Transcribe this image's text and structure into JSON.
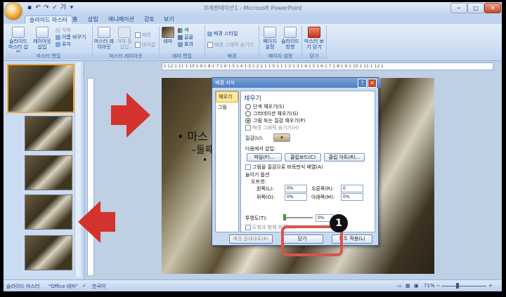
{
  "window": {
    "title": "프레젠테이션1 - Microsoft PowerPoint",
    "qat_icons": [
      "save-icon",
      "undo-icon",
      "redo-icon",
      "check-icon",
      "text-icon",
      "dropdown-icon"
    ],
    "controls": {
      "minimize": "─",
      "maximize": "□",
      "close": "✕"
    }
  },
  "tabs": [
    "슬라이드 마스터",
    "홈",
    "삽입",
    "애니메이션",
    "검토",
    "보기"
  ],
  "ribbon": {
    "groups": {
      "master_edit": {
        "label": "마스터 편집",
        "insert_master": "슬라이드 마스터 삽입",
        "insert_layout": "레이아웃 삽입",
        "delete": "삭제",
        "rename": "이름 바꾸기",
        "preserve": "유지"
      },
      "master_layout": {
        "label": "마스터 레이아웃",
        "master_layout": "마스터 레이아웃",
        "insert_placeholder": "개체 틀 삽입",
        "title": "제목",
        "footer": "바닥글"
      },
      "edit_theme": {
        "label": "테마 편집",
        "theme": "테마",
        "colors": "색",
        "fonts": "글꼴",
        "effects": "효과"
      },
      "background": {
        "label": "배경",
        "styles": "배경 스타일",
        "hide_graphics": "배경 그래픽 숨기기"
      },
      "page_setup": {
        "label": "페이지 설정",
        "setup": "페이지 설정",
        "orientation": "슬라이드 방향"
      },
      "close": {
        "label": "닫기",
        "close_view": "마스터 보기 닫기"
      }
    }
  },
  "thumbnails": {
    "numbers": [
      "1",
      "",
      "",
      "",
      "",
      ""
    ],
    "selected_index": 0
  },
  "slide": {
    "title": "마",
    "bullet1": "• 마스",
    "bullet2": "–둘째",
    "bullet3": "•"
  },
  "dialog": {
    "title": "배경 서식",
    "help": "?",
    "close": "✕",
    "categories": [
      "채우기",
      "그림"
    ],
    "fill_heading": "채우기",
    "options": [
      {
        "label": "단색 채우기(S)",
        "selected": false
      },
      {
        "label": "그라데이션 채우기(G)",
        "selected": false
      },
      {
        "label": "그림 또는 질감 채우기(P)",
        "selected": true
      },
      {
        "label": "배경 그래픽 숨기기(H)",
        "selected": false
      }
    ],
    "texture_label": "질감(U):",
    "insert_from": "다음에서 삽입:",
    "btn_file": "파일(F)...",
    "btn_clipboard": "클립보드(C)",
    "btn_clipart": "클립 아트(R)...",
    "tile_checkbox": "그림을 질감으로 바둑판식 배열(A)",
    "stretch_options": "늘이기 옵션",
    "offsets": "오프셋:",
    "left_label": "왼쪽(L):",
    "left_value": "0%",
    "right_label": "오른쪽(R):",
    "right_value": "0",
    "top_label": "위쪽(O):",
    "top_value": "0%",
    "bottom_label": "아래쪽(M):",
    "bottom_value": "0%",
    "transparency_label": "투명도(T):",
    "transparency_value": "0%",
    "rotate_checkbox": "도형과 함께 회전(W)",
    "reset_btn": "배경 원래대로(B)",
    "close_btn": "닫기",
    "apply_all_btn": "모두 적용(L)"
  },
  "callout_number": "1",
  "statusbar": {
    "view": "슬라이드 마스터",
    "theme": "\"Office 테마\"",
    "language": "한국어",
    "zoom": "71%",
    "zoom_level": 0.71
  },
  "colors": {
    "accent_arrow": "#d4322c",
    "selection": "#f1a33d",
    "dialog_title": "#4f7fc2"
  }
}
